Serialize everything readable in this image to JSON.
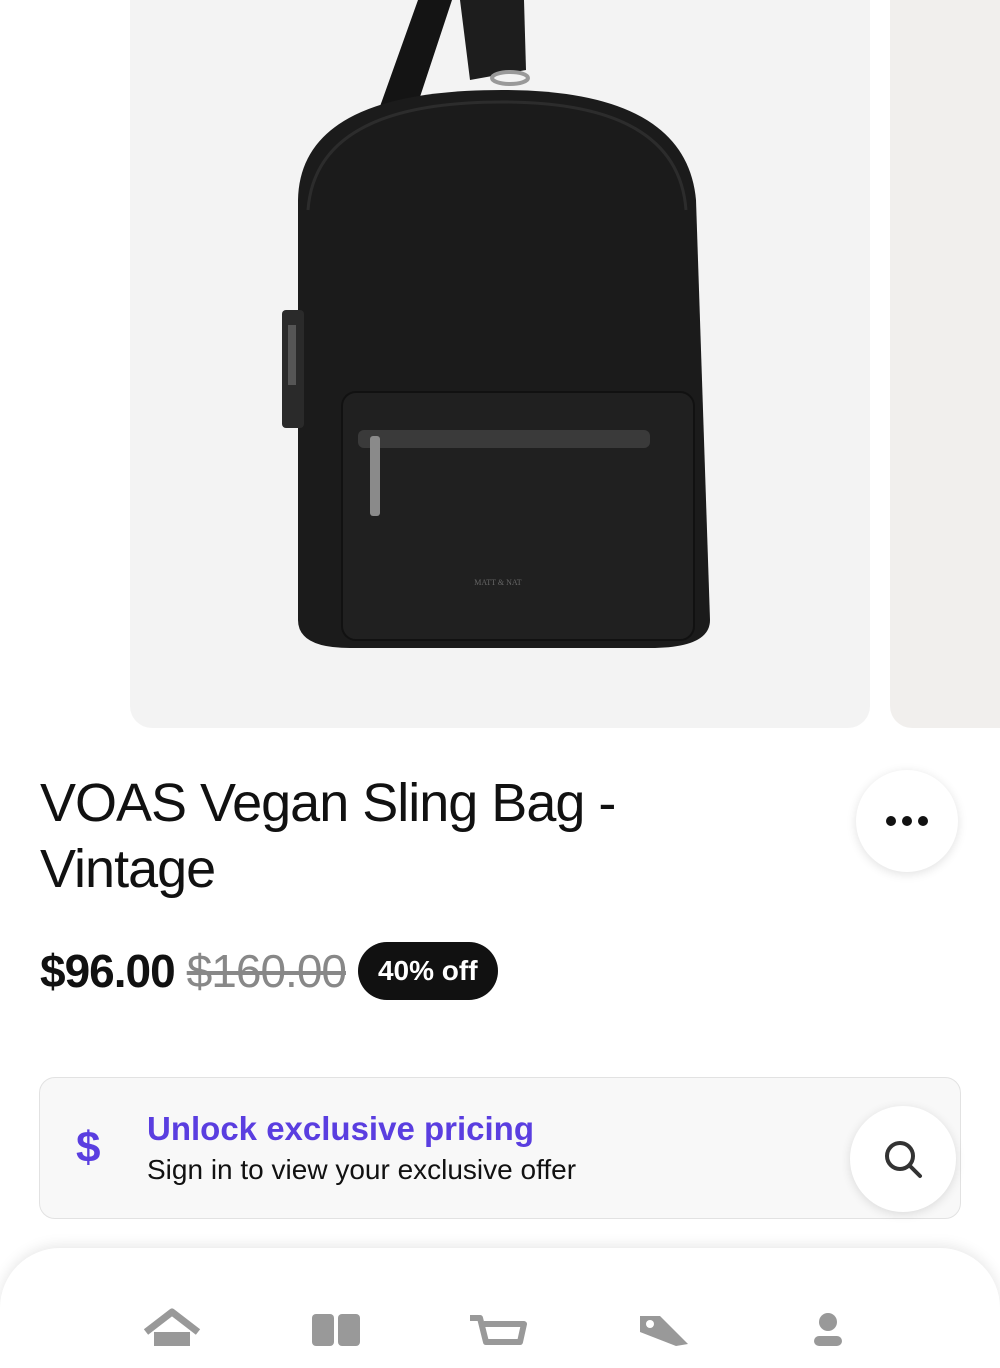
{
  "product": {
    "title_line1": "VOAS Vegan Sling Bag -",
    "title_line2": "Vintage",
    "price": "$96.00",
    "original_price": "$160.00",
    "discount": "40% off",
    "image_alt": "Black vegan leather sling bag with front zip pocket",
    "brand_mark": "MATT & NAT"
  },
  "promo": {
    "icon": "dollar-icon",
    "title": "Unlock exclusive pricing",
    "subtitle": "Sign in to view your exclusive offer",
    "accent_color": "#5a3ee0"
  },
  "actions": {
    "more_icon": "more-icon",
    "search_icon": "search-icon"
  },
  "tabbar": {
    "tabs": [
      {
        "icon": "home-icon"
      },
      {
        "icon": "categories-icon"
      },
      {
        "icon": "cart-icon"
      },
      {
        "icon": "deals-icon"
      },
      {
        "icon": "account-icon"
      }
    ]
  }
}
